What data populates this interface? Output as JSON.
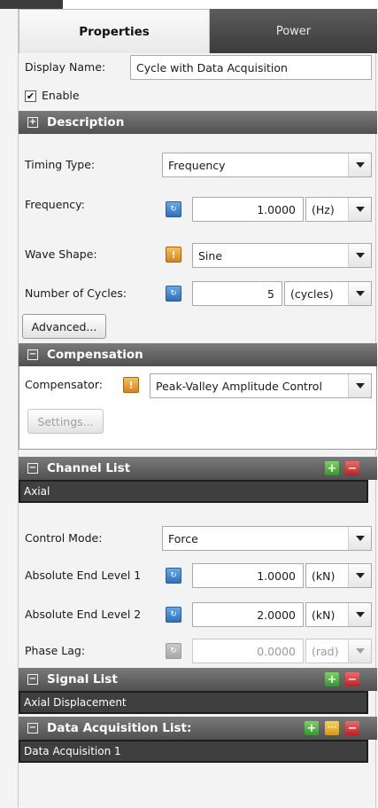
{
  "tabs": {
    "properties": "Properties",
    "power": "Power"
  },
  "display_name": {
    "label": "Display Name:",
    "value": "Cycle with Data Acquisition"
  },
  "enable": {
    "label": "Enable",
    "checked": true,
    "mark": "✔"
  },
  "sections": {
    "description": {
      "title": "Description",
      "toggle": "+"
    },
    "compensation": {
      "title": "Compensation",
      "toggle": "−"
    },
    "channel_list": {
      "title": "Channel List",
      "toggle": "−"
    },
    "signal_list": {
      "title": "Signal List",
      "toggle": "−"
    },
    "data_acquisition_list": {
      "title": "Data Acquisition List:",
      "toggle": "−"
    }
  },
  "timing_type": {
    "label": "Timing Type:",
    "value": "Frequency"
  },
  "frequency": {
    "label": "Frequency:",
    "value": "1.0000",
    "unit": "(Hz)"
  },
  "wave_shape": {
    "label": "Wave Shape:",
    "value": "Sine"
  },
  "number_of_cycles": {
    "label": "Number of Cycles:",
    "value": "5",
    "unit": "(cycles)"
  },
  "advanced_button": "Advanced...",
  "compensator": {
    "label": "Compensator:",
    "value": "Peak-Valley Amplitude Control"
  },
  "settings_button": "Settings...",
  "channel_list_items": [
    "Axial"
  ],
  "control_mode": {
    "label": "Control Mode:",
    "value": "Force"
  },
  "absolute_end_level_1": {
    "label": "Absolute End Level 1",
    "value": "1.0000",
    "unit": "(kN)"
  },
  "absolute_end_level_2": {
    "label": "Absolute End Level 2",
    "value": "2.0000",
    "unit": "(kN)"
  },
  "phase_lag": {
    "label": "Phase Lag:",
    "value": "0.0000",
    "unit": "(rad)"
  },
  "signal_list_items": [
    "Axial Displacement"
  ],
  "data_acquisition_items": [
    "Data Acquisition 1"
  ],
  "icons": {
    "add": "+",
    "remove": "−",
    "more": "···",
    "var_blue": "↻",
    "var_orange": "!"
  },
  "colors": {
    "section_header": "#5e5e5e",
    "inactive_tab": "#454545",
    "list_row": "#3f3f3f",
    "add_green": "#3aa52c",
    "remove_red": "#cc2222"
  }
}
